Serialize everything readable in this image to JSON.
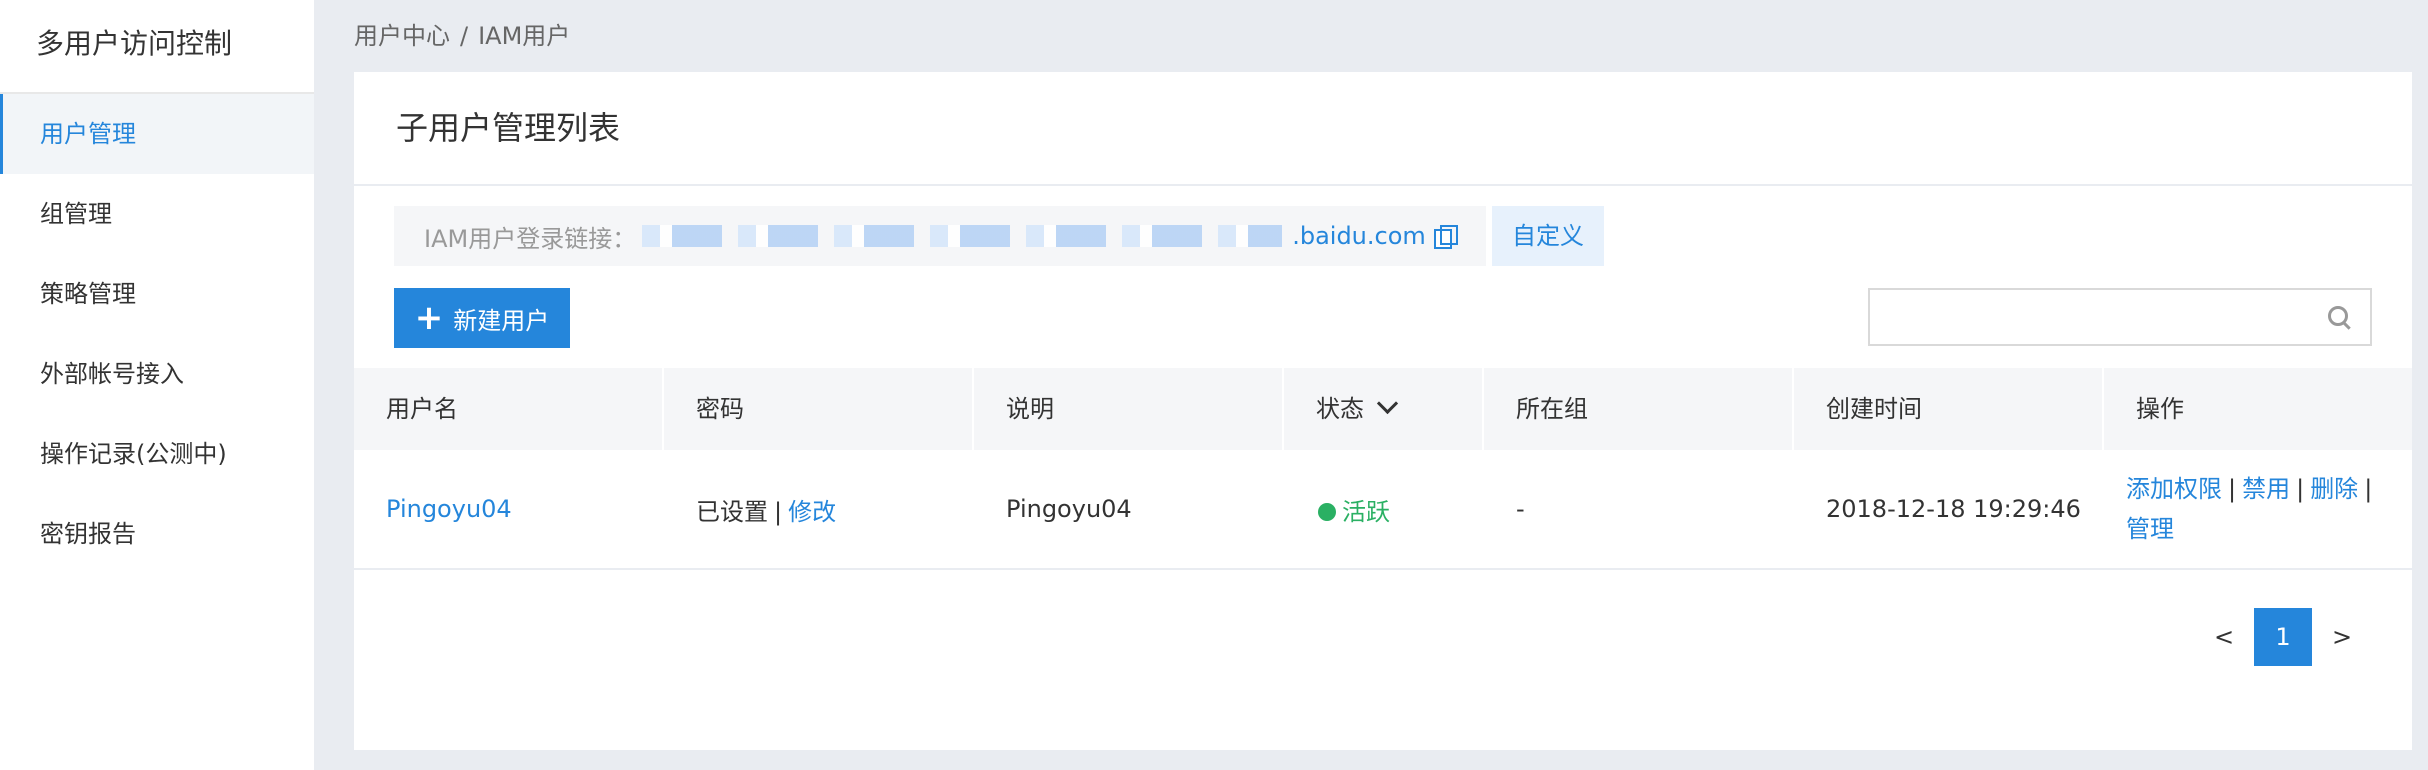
{
  "sidebar": {
    "title": "多用户访问控制",
    "items": [
      {
        "label": "用户管理",
        "active": true
      },
      {
        "label": "组管理"
      },
      {
        "label": "策略管理"
      },
      {
        "label": "外部帐号接入"
      },
      {
        "label": "操作记录(公测中)"
      },
      {
        "label": "密钥报告"
      }
    ]
  },
  "breadcrumb": {
    "root": "用户中心",
    "separator": "/",
    "current": "IAM用户"
  },
  "panel": {
    "title": "子用户管理列表",
    "login_label": "IAM用户登录链接：",
    "login_domain": ".baidu.com",
    "custom_button": "自定义",
    "new_user_button": "新建用户",
    "search_placeholder": ""
  },
  "table": {
    "headers": [
      "用户名",
      "密码",
      "说明",
      "状态",
      "所在组",
      "创建时间",
      "操作"
    ],
    "rows": [
      {
        "username": "Pingoyu04",
        "password_status": "已设置",
        "password_action": "修改",
        "description": "Pingoyu04",
        "status": "活跃",
        "group": "-",
        "created": "2018-12-18 19:29:46",
        "actions": [
          "添加权限",
          "禁用",
          "删除",
          "管理"
        ]
      }
    ]
  },
  "pagination": {
    "prev": "<",
    "current": "1",
    "next": ">"
  },
  "colors": {
    "accent": "#2586db",
    "active_status": "#2ab063"
  }
}
